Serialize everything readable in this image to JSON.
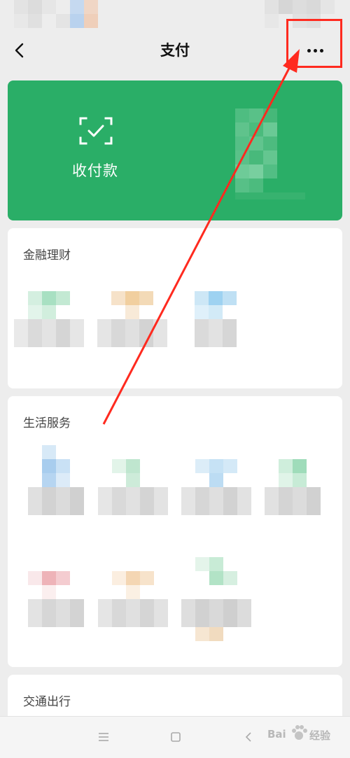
{
  "header": {
    "title": "支付",
    "back_icon": "chevron-left-icon",
    "more_icon": "more-dots-icon"
  },
  "pay_card": {
    "label": "收付款",
    "icon": "scan-check-icon",
    "color": "#2aae67"
  },
  "sections": {
    "finance": {
      "title": "金融理财"
    },
    "life": {
      "title": "生活服务"
    },
    "transport": {
      "title": "交通出行"
    }
  },
  "nav": {
    "menu_icon": "menu-icon",
    "home_icon": "square-home-icon",
    "back_icon": "back-triangle-icon"
  },
  "watermark": {
    "brand": "Bai",
    "suffix": "经验"
  },
  "annotation": {
    "color": "#ff2a1f"
  }
}
